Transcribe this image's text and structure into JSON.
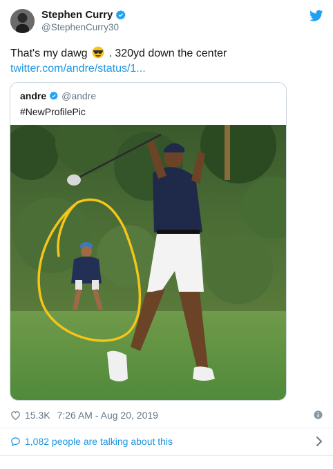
{
  "tweet": {
    "author_name": "Stephen Curry",
    "author_handle": "@StephenCurry30",
    "text_before_emoji": "That's my dawg",
    "emoji": "smiling-face-with-sunglasses",
    "text_after_emoji": ". 320yd down the center",
    "link": "twitter.com/andre/status/1...",
    "likes": "15.3K",
    "timestamp": "7:26 AM - Aug 20, 2019",
    "talking": "1,082 people are talking about this"
  },
  "quoted": {
    "author_name": "andre",
    "author_handle": "@andre",
    "text": "#NewProfilePic",
    "photo": "golf-swing-photo"
  },
  "colors": {
    "link_blue": "#1b95e0",
    "verified_blue": "#1da1f2",
    "muted_gray": "#657786",
    "annotation_yellow": "#f5c518"
  },
  "icons": [
    "verified-badge-icon",
    "twitter-bird-icon",
    "heart-icon",
    "info-icon",
    "speech-bubble-icon",
    "chevron-right-icon"
  ]
}
